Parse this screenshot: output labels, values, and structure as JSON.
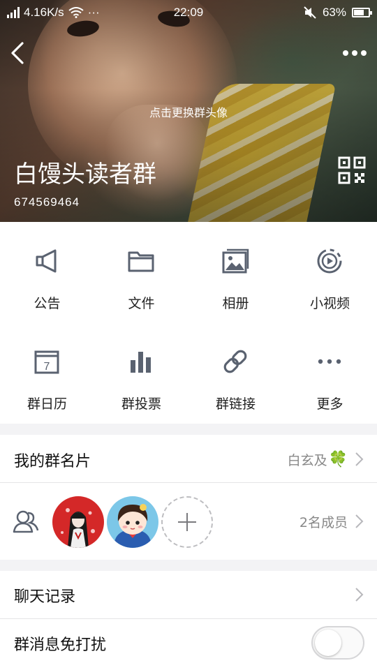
{
  "status_bar": {
    "speed": "4.16K/s",
    "dots": "···",
    "time": "22:09",
    "battery_percent": "63%",
    "battery_level": 0.63
  },
  "header": {
    "change_avatar_hint": "点击更换群头像",
    "group_name": "白馒头读者群",
    "group_id": "674569464"
  },
  "actions": [
    {
      "label": "公告",
      "icon": "megaphone-icon"
    },
    {
      "label": "文件",
      "icon": "folder-icon"
    },
    {
      "label": "相册",
      "icon": "album-icon"
    },
    {
      "label": "小视频",
      "icon": "video-icon"
    },
    {
      "label": "群日历",
      "icon": "calendar-icon"
    },
    {
      "label": "群投票",
      "icon": "poll-icon"
    },
    {
      "label": "群链接",
      "icon": "link-icon"
    },
    {
      "label": "更多",
      "icon": "more-dots-icon"
    }
  ],
  "calendar_day": "7",
  "group_card": {
    "label": "我的群名片",
    "value": "白玄及",
    "emoji": "🍀"
  },
  "members": {
    "count_label": "2名成员"
  },
  "chat_history": {
    "label": "聊天记录"
  },
  "do_not_disturb": {
    "label": "群消息免打扰",
    "enabled": false
  },
  "colors": {
    "icon_gray": "#5a6270",
    "divider": "#e4e4e6",
    "section_bg": "#f3f3f5"
  }
}
